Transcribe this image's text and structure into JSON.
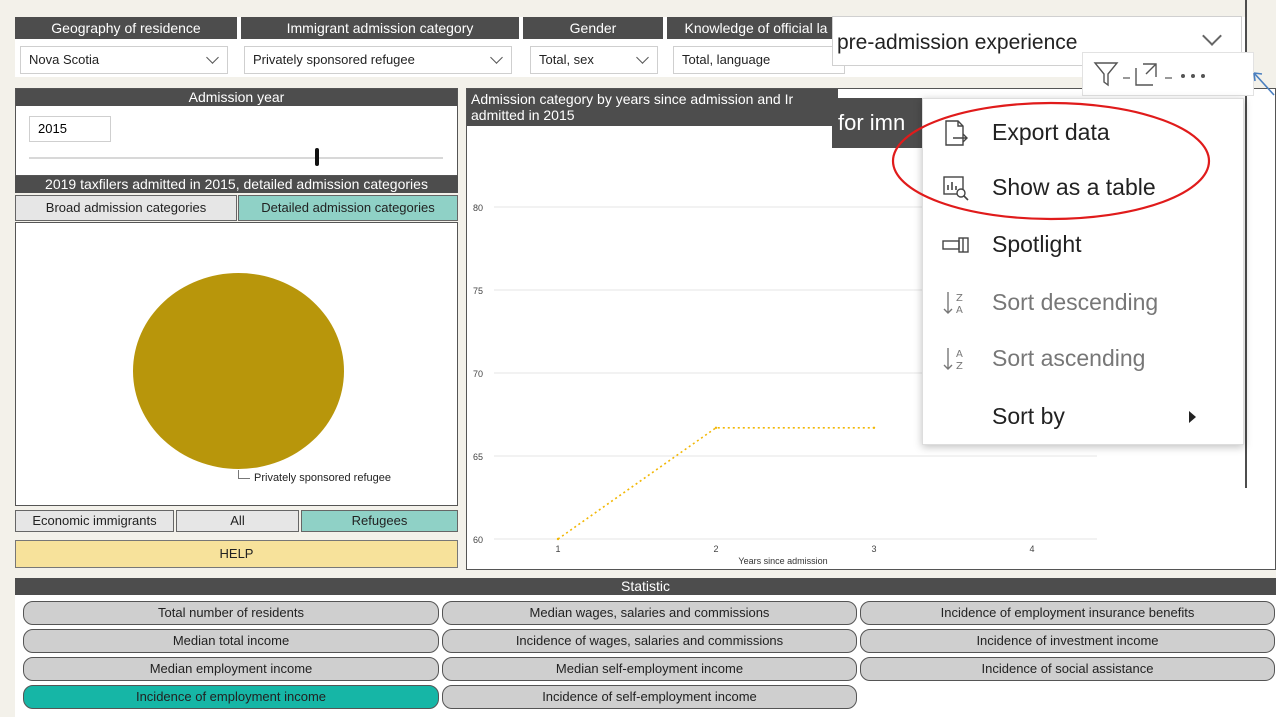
{
  "filters": [
    {
      "header": "Geography of residence",
      "value": "Nova Scotia"
    },
    {
      "header": "Immigrant admission category",
      "value": "Privately sponsored refugee"
    },
    {
      "header": "Gender",
      "value": "Total, sex"
    },
    {
      "header": "Knowledge of official la",
      "value": "Total, language"
    }
  ],
  "overlay_dropdown": {
    "text": "pre-admission experience"
  },
  "band_text": "for imn",
  "admission_year": {
    "title": "Admission year",
    "value": "2015",
    "slider_fraction": 0.66
  },
  "detail_section": {
    "title": "2019 taxfilers admitted in 2015, detailed admission categories",
    "toggles": [
      {
        "label": "Broad admission categories",
        "active": false
      },
      {
        "label": "Detailed admission categories",
        "active": true
      }
    ]
  },
  "pie": {
    "slices": [
      {
        "label": "Privately sponsored refugee",
        "value": 100,
        "color": "#b8960b"
      }
    ]
  },
  "group_toggles": [
    {
      "label": "Economic immigrants",
      "active": false
    },
    {
      "label": "All",
      "active": false
    },
    {
      "label": "Refugees",
      "active": true
    }
  ],
  "help_label": "HELP",
  "chart": {
    "title": "Admission category by years since admission and Ir admitted in 2015"
  },
  "chart_data": {
    "type": "line",
    "x": [
      1,
      2,
      3
    ],
    "series": [
      {
        "values": [
          60,
          66.7,
          66.7
        ],
        "color": "#f2b705"
      }
    ],
    "xticks": [
      "1",
      "2",
      "3",
      "4"
    ],
    "yticks": [
      "60",
      "65",
      "70",
      "75",
      "80"
    ],
    "xlabel": "Years since admission",
    "xlim": [
      1,
      4
    ],
    "ylim": [
      60,
      80
    ],
    "grid": true
  },
  "context_menu": {
    "items": [
      {
        "label": "Export data",
        "icon": "export-icon",
        "disabled": false
      },
      {
        "label": "Show as a table",
        "icon": "table-icon",
        "disabled": false
      },
      {
        "label": "Spotlight",
        "icon": "spotlight-icon",
        "disabled": false
      },
      {
        "label": "Sort descending",
        "icon": "sort-descending-icon",
        "disabled": true
      },
      {
        "label": "Sort ascending",
        "icon": "sort-ascending-icon",
        "disabled": true
      },
      {
        "label": "Sort by",
        "icon": "",
        "disabled": false,
        "submenu": true
      }
    ],
    "highlight_color": "#e01b1b"
  },
  "statistic": {
    "title": "Statistic",
    "buttons": [
      {
        "label": "Total number of residents",
        "active": false
      },
      {
        "label": "Median wages, salaries and commissions",
        "active": false
      },
      {
        "label": "Incidence of employment insurance benefits",
        "active": false
      },
      {
        "label": "Median total income",
        "active": false
      },
      {
        "label": "Incidence of wages, salaries and commissions",
        "active": false
      },
      {
        "label": "Incidence of investment income",
        "active": false
      },
      {
        "label": "Median employment income",
        "active": false
      },
      {
        "label": "Median self-employment income",
        "active": false
      },
      {
        "label": "Incidence of social assistance",
        "active": false
      },
      {
        "label": "Incidence of employment income",
        "active": true
      },
      {
        "label": "Incidence of self-employment income",
        "active": false
      }
    ]
  }
}
